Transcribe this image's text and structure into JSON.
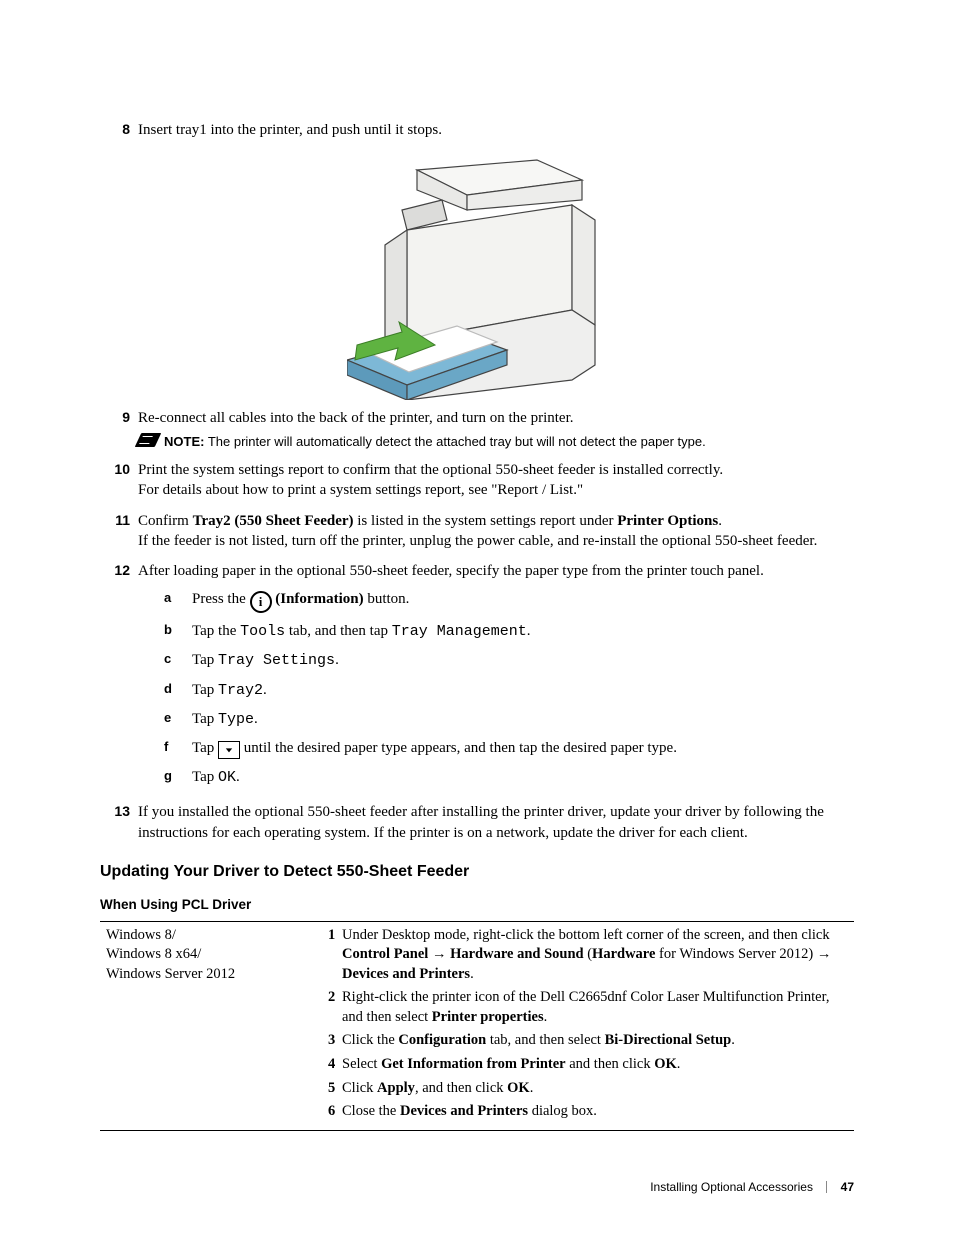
{
  "steps": {
    "s8": {
      "num": "8",
      "text": "Insert tray1 into the printer, and push until it stops."
    },
    "s9": {
      "num": "9",
      "text": "Re-connect all cables into the back of the printer, and turn on the printer.",
      "note_label": "NOTE:",
      "note_text": " The printer will automatically detect the attached tray but will not detect the paper type."
    },
    "s10": {
      "num": "10",
      "line1": "Print the system settings report to confirm that the optional 550-sheet feeder is installed correctly.",
      "line2": "For details about how to print a system settings report, see \"Report / List.\""
    },
    "s11": {
      "num": "11",
      "pre": "Confirm ",
      "bold": "Tray2 (550 Sheet Feeder)",
      "mid": " is listed in the system settings report under ",
      "bold2": "Printer Options",
      "post": ".",
      "line2": "If the feeder is not listed, turn off the printer, unplug the power cable, and re-install the optional 550-sheet feeder."
    },
    "s12": {
      "num": "12",
      "text": "After loading paper in the optional 550-sheet feeder, specify the paper type from the printer touch panel.",
      "a_letter": "a",
      "a_pre": "Press the ",
      "a_mid_bold": " (Information)",
      "a_post": " button.",
      "b_letter": "b",
      "b_pre": "Tap the ",
      "b_mono1": "Tools",
      "b_mid": " tab, and then tap ",
      "b_mono2": "Tray Management",
      "b_post": ".",
      "c_letter": "c",
      "c_pre": "Tap ",
      "c_mono": "Tray Settings",
      "c_post": ".",
      "d_letter": "d",
      "d_pre": "Tap ",
      "d_mono": "Tray2",
      "d_post": ".",
      "e_letter": "e",
      "e_pre": "Tap ",
      "e_mono": "Type",
      "e_post": ".",
      "f_letter": "f",
      "f_pre": "Tap  ",
      "f_post": " until the desired paper type appears, and then tap the desired paper type.",
      "g_letter": "g",
      "g_pre": "Tap ",
      "g_mono": "OK",
      "g_post": "."
    },
    "s13": {
      "num": "13",
      "text": "If you installed the optional 550-sheet feeder after installing the printer driver, update your driver by following the instructions for each operating system. If the printer is on a network, update the driver for each client."
    }
  },
  "headings": {
    "h2": "Updating Your Driver to Detect 550-Sheet Feeder",
    "h3": "When Using PCL Driver"
  },
  "table": {
    "os1": "Windows 8/",
    "os2": "Windows 8 x64/",
    "os3": "Windows Server 2012",
    "r1n": "1",
    "r1a": " Under Desktop mode, right-click the bottom left corner of the screen, and then click ",
    "r1b": "Control Panel",
    "r1arr1": " → ",
    "r1c": "Hardware and Sound",
    "r1d": " (",
    "r1e": "Hardware",
    "r1f": " for Windows Server 2012) ",
    "r1arr2": "→ ",
    "r1g": "Devices and Printers",
    "r1h": ".",
    "r2n": "2",
    "r2a": " Right-click the printer icon of the Dell C2665dnf Color Laser Multifunction Printer, and then select ",
    "r2b": "Printer properties",
    "r2c": ".",
    "r3n": "3",
    "r3a": " Click the ",
    "r3b": "Configuration",
    "r3c": " tab, and then select ",
    "r3d": "Bi-Directional Setup",
    "r3e": ".",
    "r4n": "4",
    "r4a": " Select ",
    "r4b": "Get Information from Printer",
    "r4c": " and then click ",
    "r4d": "OK",
    "r4e": ".",
    "r5n": "5",
    "r5a": " Click ",
    "r5b": "Apply",
    "r5c": ", and then click ",
    "r5d": "OK",
    "r5e": ".",
    "r6n": "6",
    "r6a": " Close the ",
    "r6b": "Devices and Printers",
    "r6c": " dialog box."
  },
  "info_button_char": "i",
  "footer": {
    "title": "Installing Optional Accessories",
    "page": "47"
  }
}
